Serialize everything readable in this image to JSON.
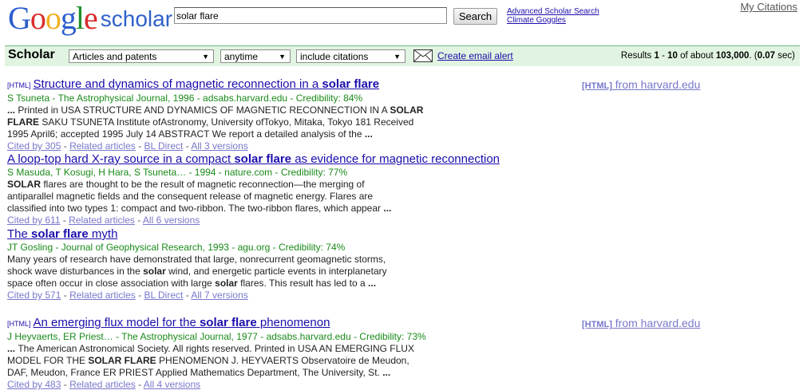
{
  "logo": {
    "letters": [
      "G",
      "o",
      "o",
      "g",
      "l",
      "e"
    ],
    "product": "scholar"
  },
  "search": {
    "value": "solar flare",
    "button": "Search"
  },
  "header_links": {
    "advanced": "Advanced Scholar Search",
    "goggles": "Climate Goggles",
    "my_citations": "My Citations"
  },
  "bar": {
    "title": "Scholar",
    "filter_type": "Articles and patents",
    "filter_time": "anytime",
    "filter_citations": "include citations",
    "email_alert": "Create email alert",
    "results_prefix": "Results ",
    "results_range_start": "1",
    "results_sep": " - ",
    "results_range_end": "10",
    "results_of": " of about ",
    "results_total": "103,000",
    "results_dot": ". (",
    "results_time": "0.07",
    "results_sec": " sec)"
  },
  "results": [
    {
      "tag": "[HTML]",
      "title_parts": [
        "Structure and dynamics of magnetic reconnection in a ",
        "solar flare",
        ""
      ],
      "meta": "S Tsuneta - The Astrophysical Journal, 1996 - adsabs.harvard.edu - Credibility: 84%",
      "snippet": [
        [
          "... ",
          "Printed in USA STRUCTURE AND DYNAMICS OF MAGNETIC RECONNECTION IN A ",
          "SOLAR"
        ],
        [
          "FLARE",
          " SAKU TSUNETA Institute ofAstronomy, University ofTokyo, Mitaka, Tokyo 181 Received",
          ""
        ],
        [
          "",
          "1995 April6; accepted 1995 July 14 ABSTRACT We report a detailed analysis of the ",
          "..."
        ]
      ],
      "links": [
        "Cited by 305",
        "Related articles",
        "BL Direct",
        "All 3 versions"
      ],
      "side_tag": "[HTML]",
      "side": " from harvard.edu"
    },
    {
      "tag": "",
      "title_parts": [
        "A loop-top hard X-ray source in a compact ",
        "solar flare",
        " as evidence for magnetic reconnection"
      ],
      "meta": "S Masuda, T Kosugi, H Hara, S Tsuneta… - 1994 - nature.com - Credibility: 77%",
      "snippet": [
        [
          "SOLAR",
          " flares are thought to be the result of magnetic reconnection—the merging of",
          ""
        ],
        [
          "",
          "antiparallel magnetic fields and the consequent release of magnetic energy. Flares are",
          ""
        ],
        [
          "",
          "classified into two types 1: compact and two-ribbon. The two-ribbon flares, which appear ",
          "..."
        ]
      ],
      "links": [
        "Cited by 611",
        "Related articles",
        "All 6 versions"
      ],
      "side_tag": "",
      "side": ""
    },
    {
      "tag": "",
      "title_parts": [
        "The ",
        "solar flare",
        " myth"
      ],
      "meta": "JT Gosling - Journal of Geophysical Research, 1993 - agu.org - Credibility: 74%",
      "snippet": [
        [
          "",
          "Many years of research have demonstrated that large, nonrecurrent geomagnetic storms,",
          ""
        ],
        [
          "",
          "shock wave disturbances in the ",
          "solar"
        ],
        [
          "",
          "space often occur in close association with large ",
          "solar"
        ]
      ],
      "snippet_tails": [
        "",
        " wind, and energetic particle events in interplanetary",
        " flares. This result has led to a "
      ],
      "snippet_ends": [
        "",
        "",
        "..."
      ],
      "links": [
        "Cited by 571",
        "Related articles",
        "BL Direct",
        "All 7 versions"
      ],
      "side_tag": "",
      "side": ""
    },
    {
      "tag": "[HTML]",
      "title_parts": [
        "An emerging flux model for the ",
        "solar flare",
        " phenomenon"
      ],
      "meta": "J Heyvaerts, ER Priest… - The Astrophysical Journal, 1977 - adsabs.harvard.edu - Credibility: 73%",
      "snippet": [
        [
          "... ",
          "The American Astronomical Society. All rights reserved. Printed in USA AN EMERGING FLUX",
          ""
        ],
        [
          "",
          "MODEL FOR THE ",
          "SOLAR FLARE"
        ],
        [
          "",
          "DAF, Meudon, France ER PRIEST Applied Mathematics Department, The University, St. ",
          "..."
        ]
      ],
      "snippet_tails": [
        "",
        " PHENOMENON J. HEYVAERTS Observatoire de Meudon,",
        ""
      ],
      "links": [
        "Cited by 483",
        "Related articles",
        "All 4 versions"
      ],
      "side_tag": "[HTML]",
      "side": " from harvard.edu"
    }
  ],
  "colors": {
    "logo": [
      "#2b5dcd",
      "#d92b2b",
      "#f0b021",
      "#2b5dcd",
      "#1f8f2b",
      "#d92b2b"
    ],
    "bar": "#e1f4e1",
    "meta": "#1a8a1a",
    "link": "#1a0dab",
    "visited": "#7777cc"
  }
}
